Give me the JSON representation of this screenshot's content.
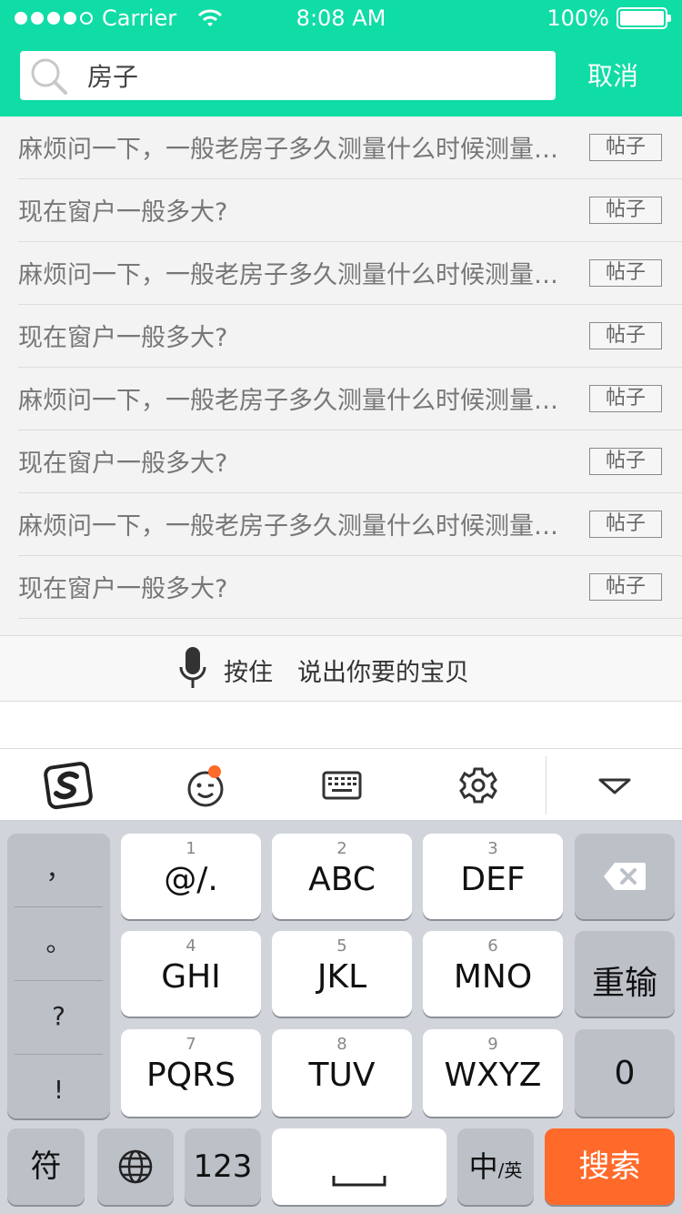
{
  "status_bar": {
    "carrier": "Carrier",
    "time": "8:08 AM",
    "battery": "100%"
  },
  "search": {
    "value": "房子",
    "cancel_label": "取消"
  },
  "suggestions": [
    {
      "text": "麻烦问一下，一般老房子多久测量什么时候测量…",
      "tag": "帖子"
    },
    {
      "text": "现在窗户一般多大?",
      "tag": "帖子"
    },
    {
      "text": "麻烦问一下，一般老房子多久测量什么时候测量…",
      "tag": "帖子"
    },
    {
      "text": "现在窗户一般多大?",
      "tag": "帖子"
    },
    {
      "text": "麻烦问一下，一般老房子多久测量什么时候测量…",
      "tag": "帖子"
    },
    {
      "text": "现在窗户一般多大?",
      "tag": "帖子"
    },
    {
      "text": "麻烦问一下，一般老房子多久测量什么时候测量…",
      "tag": "帖子"
    },
    {
      "text": "现在窗户一般多大?",
      "tag": "帖子"
    }
  ],
  "voice": {
    "label": "按住　说出你要的宝贝"
  },
  "keyboard": {
    "punctuation": [
      "，",
      "。",
      "?",
      "!"
    ],
    "keys": [
      {
        "num": "1",
        "letters": "@/."
      },
      {
        "num": "2",
        "letters": "ABC"
      },
      {
        "num": "3",
        "letters": "DEF"
      },
      {
        "num": "4",
        "letters": "GHI"
      },
      {
        "num": "5",
        "letters": "JKL"
      },
      {
        "num": "6",
        "letters": "MNO"
      },
      {
        "num": "7",
        "letters": "PQRS"
      },
      {
        "num": "8",
        "letters": "TUV"
      },
      {
        "num": "9",
        "letters": "WXYZ"
      }
    ],
    "reenter_label": "重输",
    "zero_label": "0",
    "symbol_label": "符",
    "numbers_label": "123",
    "lang_main": "中",
    "lang_sub": "/英",
    "search_label": "搜索"
  },
  "colors": {
    "header": "#10dca6",
    "search_key": "#ff6a2b",
    "notification_dot": "#ff6a2b"
  }
}
